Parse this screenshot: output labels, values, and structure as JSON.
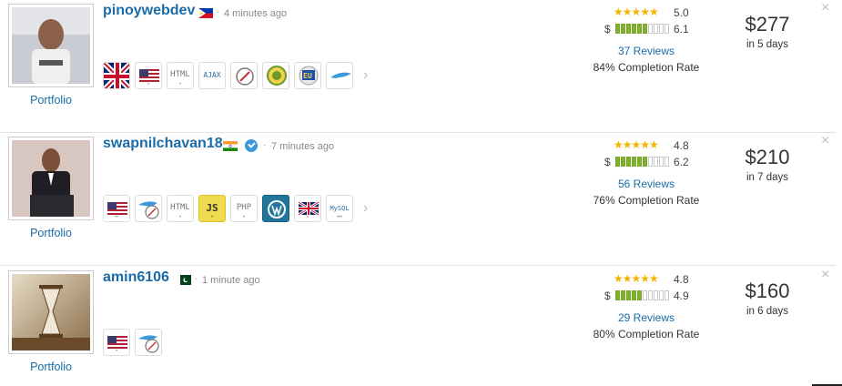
{
  "colors": {
    "link": "#1a6ba8",
    "star": "#f4b400",
    "bar_on": "#7fb22b"
  },
  "bids": [
    {
      "username": "pinoywebdev",
      "country_flag": "philippines-flag",
      "verified": false,
      "time": "4 minutes ago",
      "portfolio_label": "Portfolio",
      "rating": "5.0",
      "earnings_score": "6.1",
      "earnings_bar_filled": 6,
      "reviews": "37 Reviews",
      "completion": "84% Completion Rate",
      "price": "$277",
      "days": "in 5 days",
      "badges": [
        "uk-flag",
        "us-flag",
        "html-icon",
        "ajax-icon",
        "compass-icon",
        "seal-icon",
        "eu-icon",
        "plane-icon"
      ]
    },
    {
      "username": "swapnilchavan18",
      "country_flag": "india-flag",
      "verified": true,
      "time": "7 minutes ago",
      "portfolio_label": "Portfolio",
      "rating": "4.8",
      "earnings_score": "6.2",
      "earnings_bar_filled": 6,
      "reviews": "56 Reviews",
      "completion": "76% Completion Rate",
      "price": "$210",
      "days": "in 7 days",
      "badges": [
        "us-flag",
        "plane-compass-icon",
        "html-icon",
        "javascript-icon",
        "php-icon",
        "wordpress-icon",
        "uk-flag",
        "mysql-icon"
      ]
    },
    {
      "username": "amin6106",
      "country_flag": "pakistan-flag",
      "verified": false,
      "time": "1 minute ago",
      "portfolio_label": "Portfolio",
      "rating": "4.8",
      "earnings_score": "4.9",
      "earnings_bar_filled": 5,
      "reviews": "29 Reviews",
      "completion": "80% Completion Rate",
      "price": "$160",
      "days": "in 6 days",
      "badges": [
        "us-flag",
        "plane-compass-icon"
      ]
    }
  ],
  "badge_text": {
    "html": "HTML",
    "ajax": "AJAX",
    "js": "JS",
    "php": "PHP",
    "eu": "EU",
    "mysql": "MySQL"
  },
  "dollar_sign": "$",
  "stars_glyph": "★★★★★"
}
